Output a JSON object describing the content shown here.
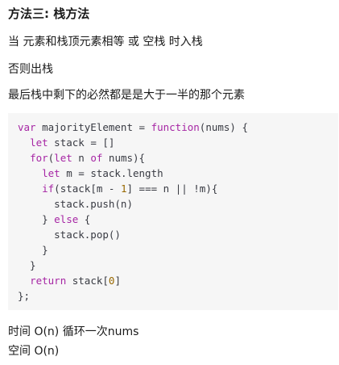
{
  "heading": "方法三: 栈方法",
  "paragraphs": [
    "当 元素和栈顶元素相等 或 空栈 时入栈",
    "否则出栈",
    "最后栈中剩下的必然都是是大于一半的那个元素"
  ],
  "code": {
    "lines": [
      [
        {
          "t": "var",
          "c": "kw"
        },
        {
          "t": " majorityElement = "
        },
        {
          "t": "function",
          "c": "kw"
        },
        {
          "t": "(nums) {"
        }
      ],
      [
        {
          "t": "  "
        },
        {
          "t": "let",
          "c": "kw"
        },
        {
          "t": " stack = []"
        }
      ],
      [
        {
          "t": "  "
        },
        {
          "t": "for",
          "c": "kw"
        },
        {
          "t": "("
        },
        {
          "t": "let",
          "c": "kw"
        },
        {
          "t": " n "
        },
        {
          "t": "of",
          "c": "kw"
        },
        {
          "t": " nums){"
        }
      ],
      [
        {
          "t": "    "
        },
        {
          "t": "let",
          "c": "kw"
        },
        {
          "t": " m = stack.length"
        }
      ],
      [
        {
          "t": "    "
        },
        {
          "t": "if",
          "c": "kw"
        },
        {
          "t": "(stack[m - "
        },
        {
          "t": "1",
          "c": "num"
        },
        {
          "t": "] === n || !m){"
        }
      ],
      [
        {
          "t": "      stack.push(n)"
        }
      ],
      [
        {
          "t": "    } "
        },
        {
          "t": "else",
          "c": "kw"
        },
        {
          "t": " {"
        }
      ],
      [
        {
          "t": "      stack.pop()"
        }
      ],
      [
        {
          "t": "    }"
        }
      ],
      [
        {
          "t": "  }"
        }
      ],
      [
        {
          "t": "  "
        },
        {
          "t": "return",
          "c": "kw"
        },
        {
          "t": " stack["
        },
        {
          "t": "0",
          "c": "num"
        },
        {
          "t": "]"
        }
      ],
      [
        {
          "t": "};"
        }
      ]
    ]
  },
  "complexity": [
    "时间 O(n) 循环一次nums",
    "空间 O(n)"
  ]
}
